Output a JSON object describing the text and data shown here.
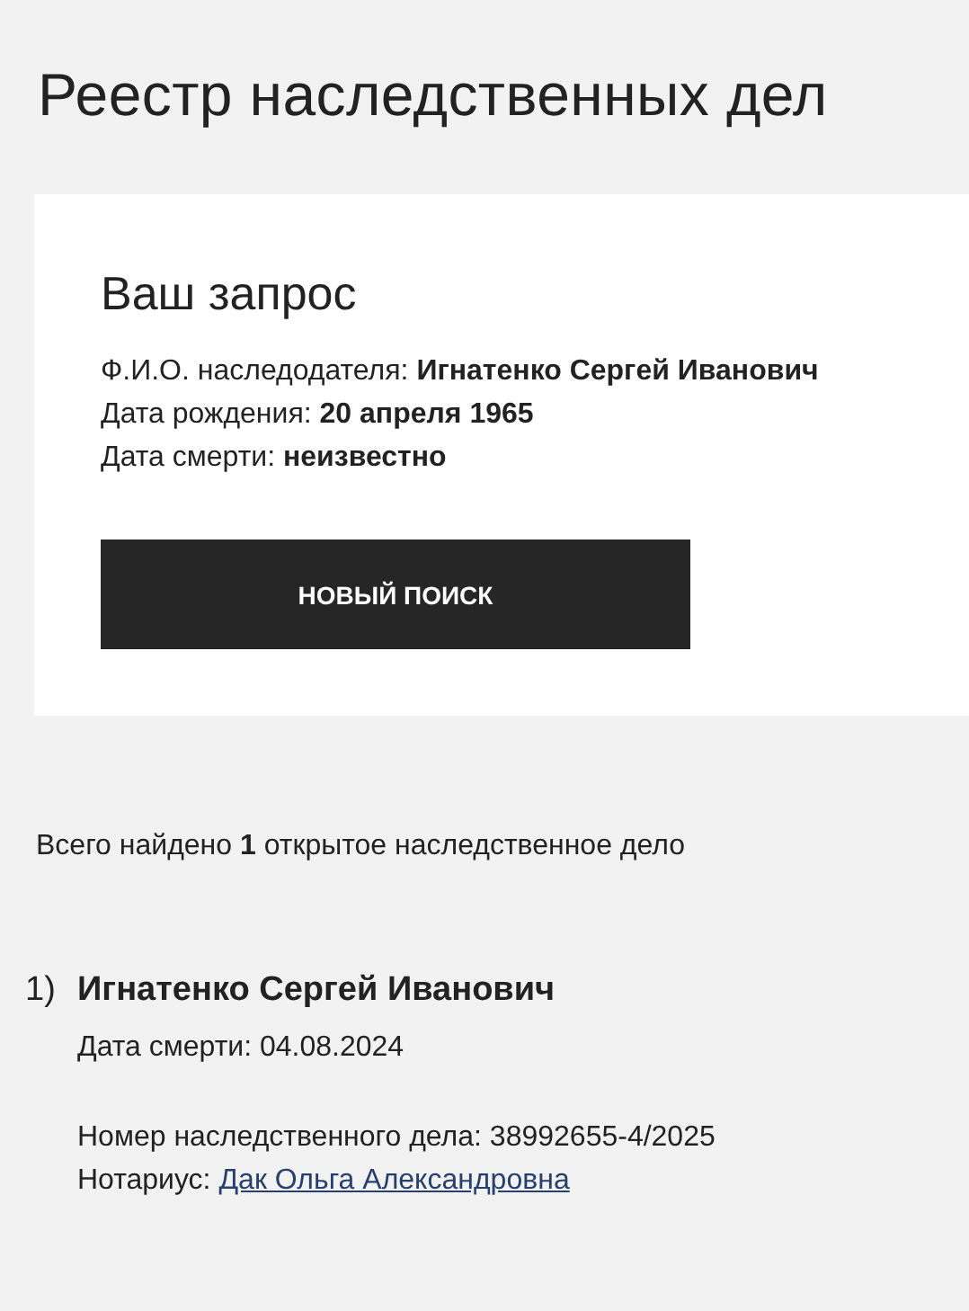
{
  "title": "Реестр наследственных дел",
  "query": {
    "heading": "Ваш запрос",
    "lines": [
      {
        "label": "Ф.И.О. наследодателя: ",
        "value": "Игнатенко Сергей Иванович"
      },
      {
        "label": "Дата рождения: ",
        "value": "20 апреля 1965"
      },
      {
        "label": "Дата смерти: ",
        "value": "неизвестно"
      }
    ],
    "button": "НОВЫЙ ПОИСК"
  },
  "summary": "Всего найдено **1** открытое наследственное дело",
  "results": [
    {
      "number": "1)",
      "name": "Игнатенко Сергей Иванович",
      "death_date": "Дата смерти: 04.08.2024",
      "case_number": "Номер наследственного дела: 38992655-4/2025",
      "notary_label": "Нотариус: ",
      "notary": "Дак Ольга Александровна"
    }
  ]
}
